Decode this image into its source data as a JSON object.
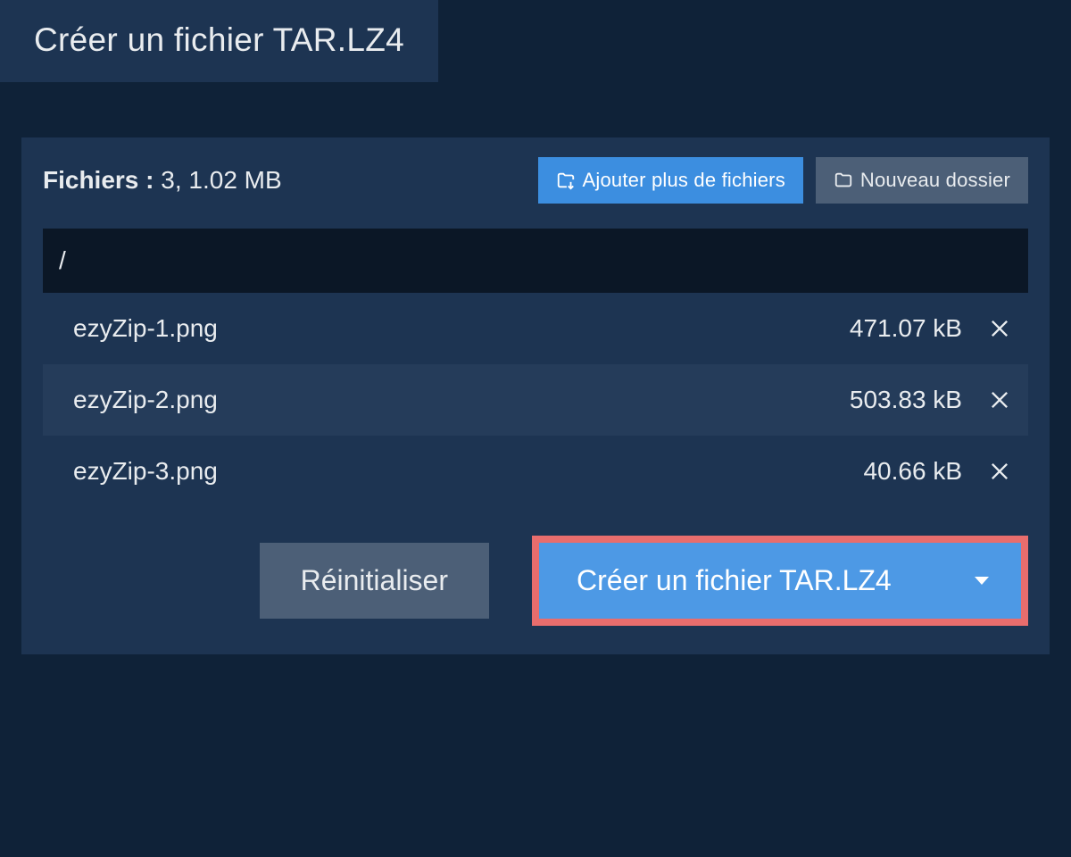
{
  "tab_title": "Créer un fichier TAR.LZ4",
  "summary": {
    "label_prefix": "Fichiers :",
    "count_size": " 3, 1.02 MB"
  },
  "buttons": {
    "add_more": "Ajouter plus de fichiers",
    "new_folder": "Nouveau dossier",
    "reset": "Réinitialiser",
    "create": "Créer un fichier TAR.LZ4"
  },
  "path": "/",
  "files": [
    {
      "name": "ezyZip-1.png",
      "size": "471.07 kB"
    },
    {
      "name": "ezyZip-2.png",
      "size": "503.83 kB"
    },
    {
      "name": "ezyZip-3.png",
      "size": "40.66 kB"
    }
  ]
}
